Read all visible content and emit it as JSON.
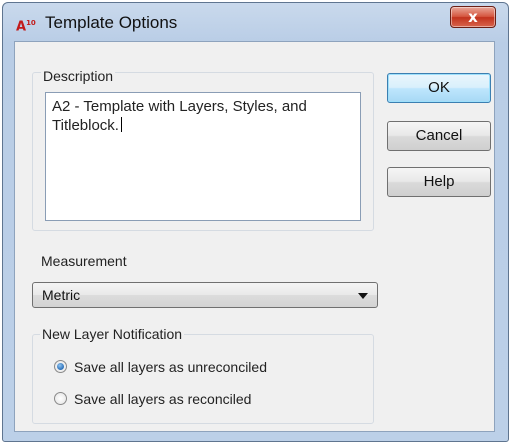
{
  "window": {
    "title": "Template Options",
    "app_icon_text": "A",
    "app_icon_sub": "10",
    "close_glyph": "x"
  },
  "description": {
    "group_label": "Description",
    "value": "A2 - Template with Layers, Styles, and Titleblock."
  },
  "buttons": {
    "ok": "OK",
    "cancel": "Cancel",
    "help": "Help"
  },
  "measurement": {
    "label": "Measurement",
    "selected": "Metric"
  },
  "layer_notification": {
    "group_label": "New Layer Notification",
    "options": [
      {
        "label": "Save all layers as unreconciled",
        "checked": true
      },
      {
        "label": "Save all layers as reconciled",
        "checked": false
      }
    ]
  },
  "colors": {
    "title_bar": "#c9d9ec",
    "close_button": "#c2321d",
    "default_button_border": "#3c7fb1"
  }
}
